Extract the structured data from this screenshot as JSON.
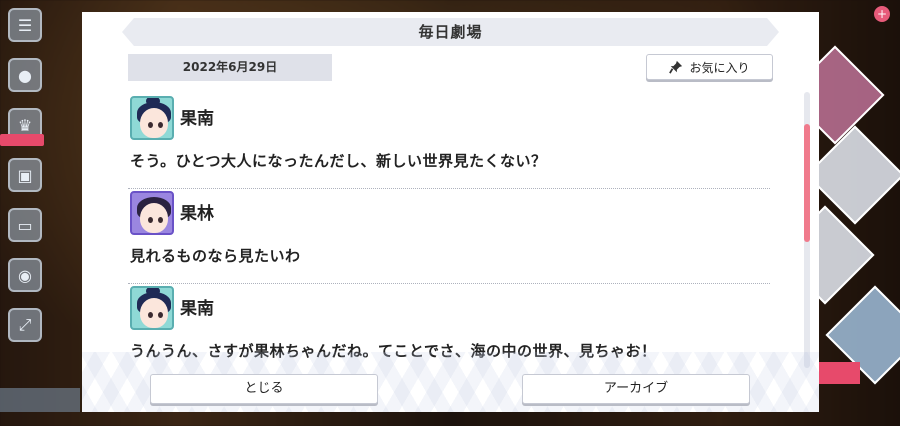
{
  "dialog": {
    "title": "毎日劇場",
    "date": "2022年6月29日",
    "favorite_label": "お気に入り",
    "close_label": "とじる",
    "archive_label": "アーカイブ"
  },
  "entries": [
    {
      "name": "果南",
      "text": "そう。ひとつ大人になったんだし、新しい世界見たくない？",
      "avatar": "kanan-avatar"
    },
    {
      "name": "果林",
      "text": "見れるものなら見たいわ",
      "avatar": "karin-avatar"
    },
    {
      "name": "果南",
      "text": "うんうん、さすが果林ちゃんだね。てことでさ、海の中の世界、見ちゃお！",
      "avatar": "kanan-avatar"
    }
  ],
  "colors": {
    "accent": "#f07a8c",
    "title_bar": "#e9ebf1",
    "date_bg": "#dfe1e9"
  },
  "scroll": {
    "position_fraction": 0.2
  }
}
